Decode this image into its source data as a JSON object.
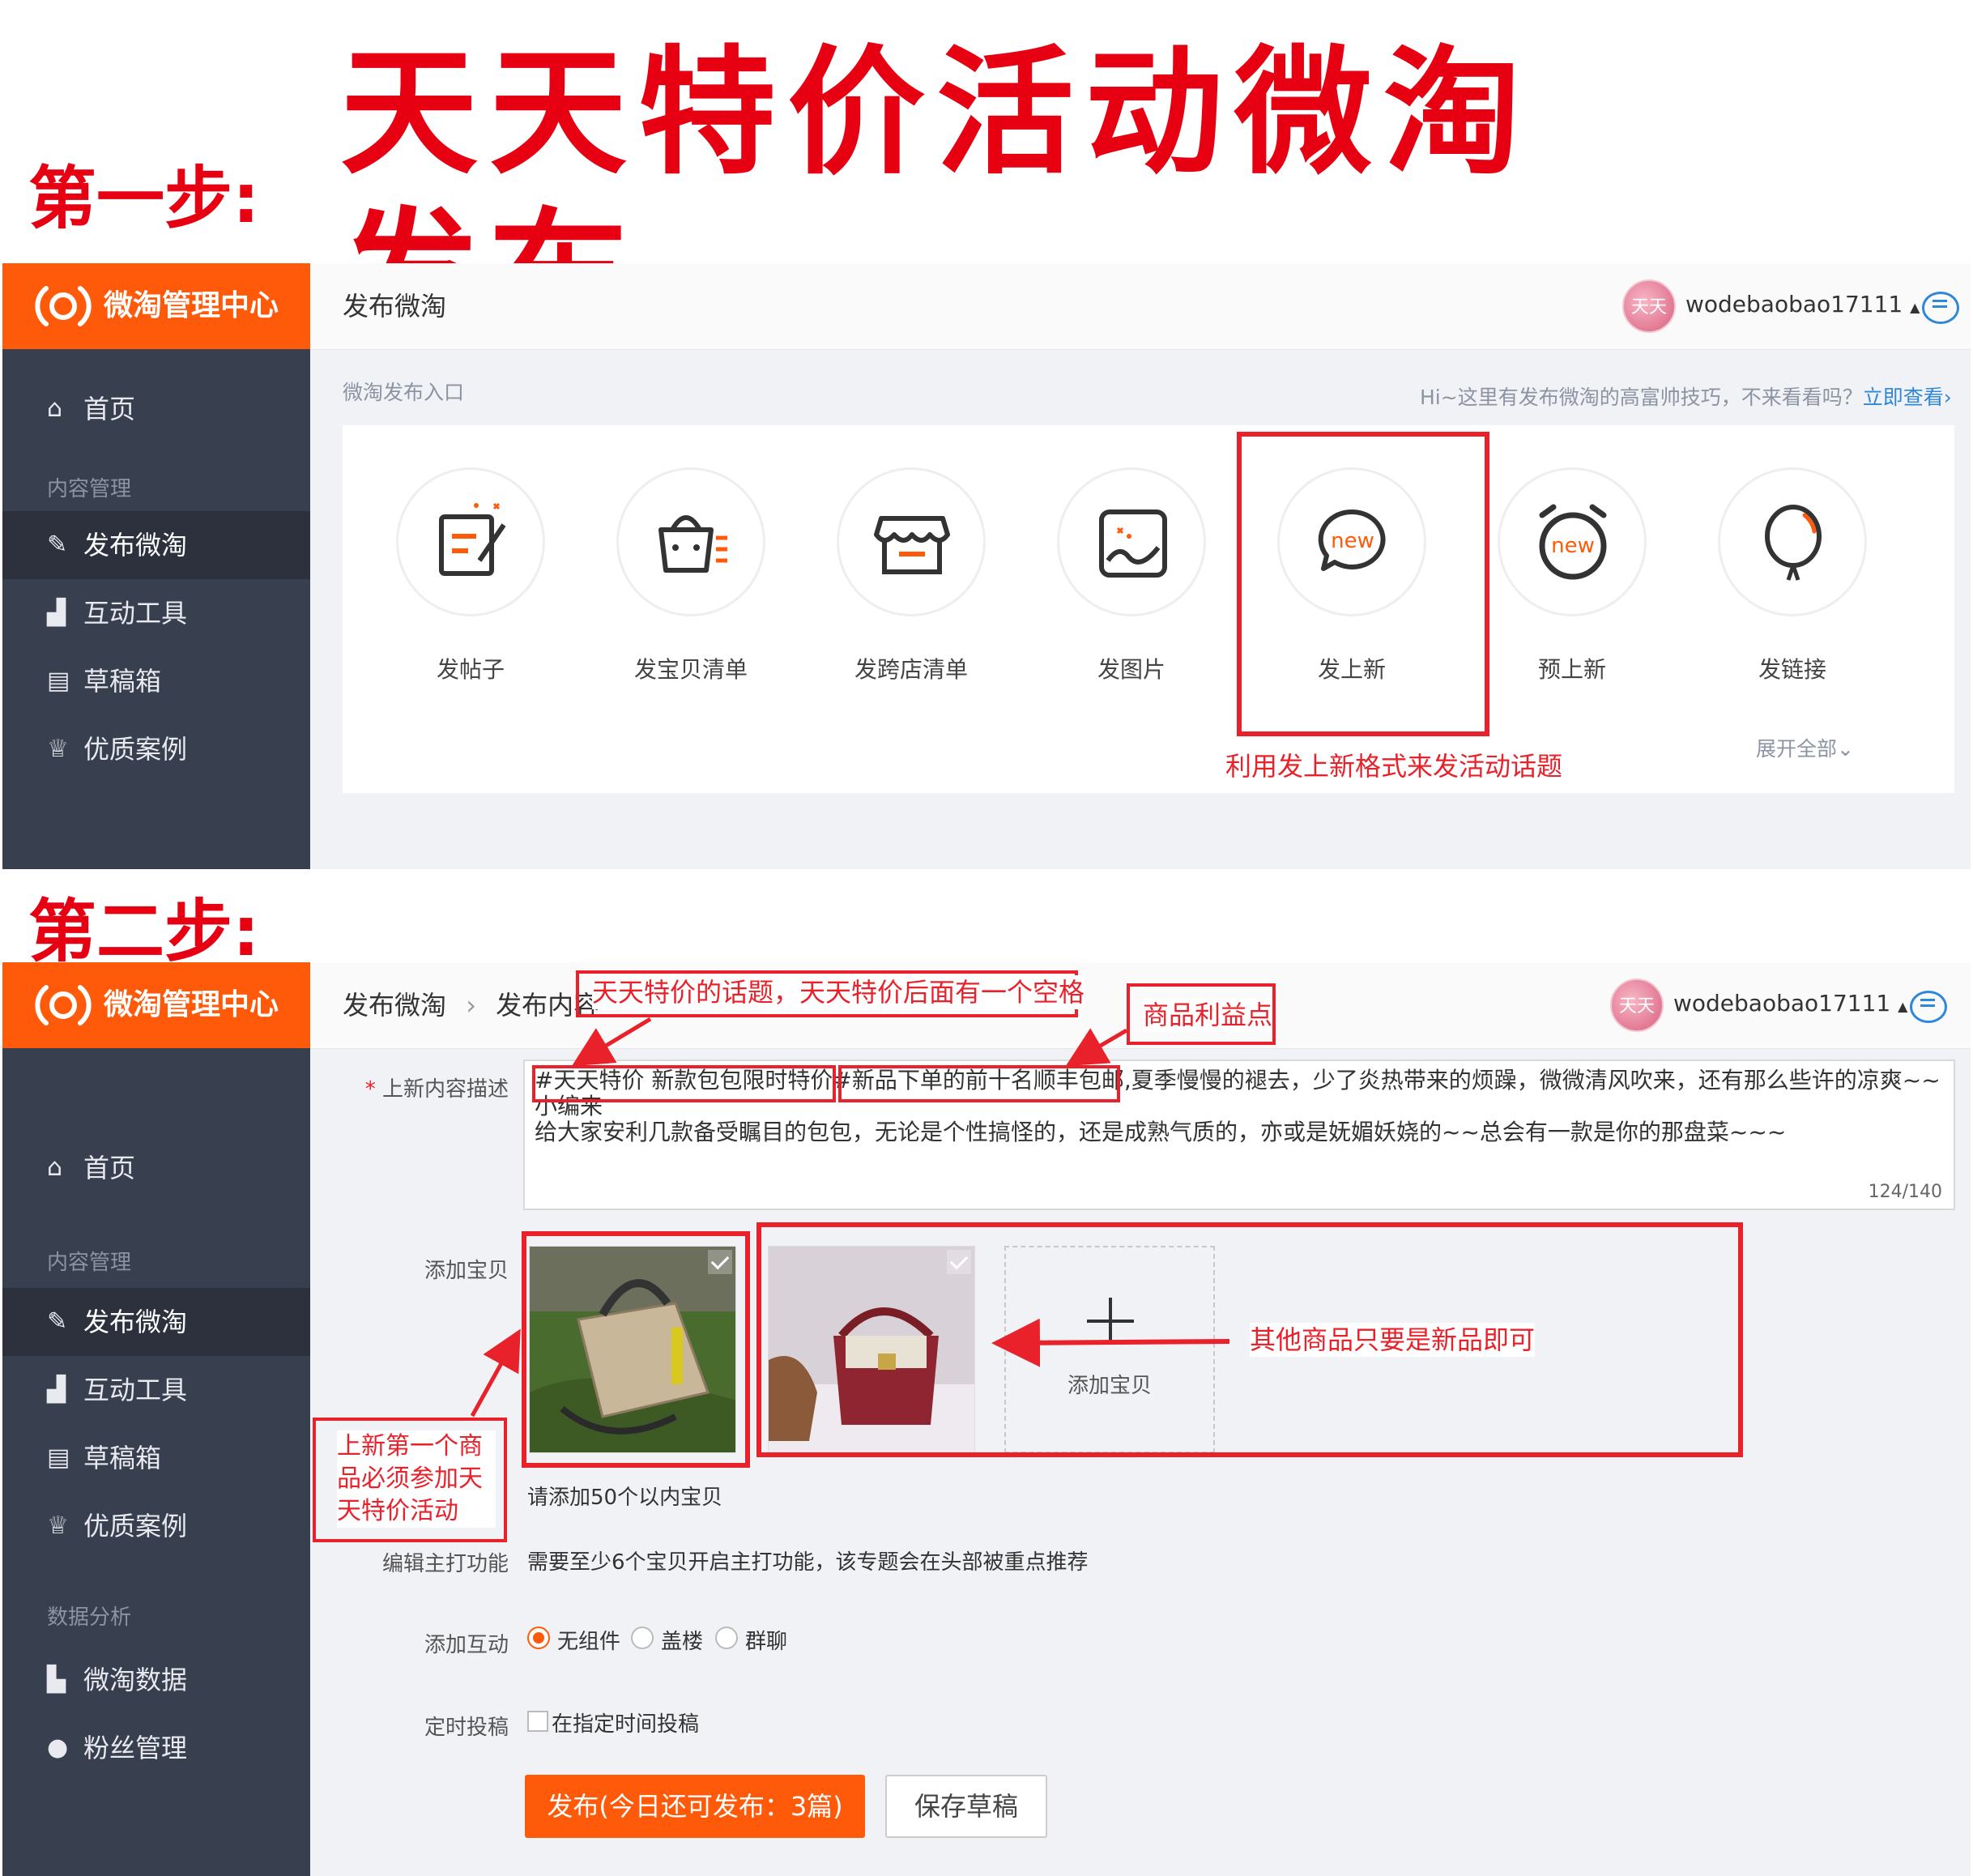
{
  "page": {
    "main_title": "天天特价活动微淘发布",
    "step1_label": "第一步:",
    "step2_label": "第二步:"
  },
  "app": {
    "brand": "微淘管理中心",
    "username": "wodebaobao17111",
    "avatar_text": "天天"
  },
  "sidebar1": {
    "home": "首页",
    "section_content": "内容管理",
    "publish": "发布微淘",
    "interact": "互动工具",
    "drafts": "草稿箱",
    "cases": "优质案例"
  },
  "sidebar2": {
    "home": "首页",
    "section_content": "内容管理",
    "publish": "发布微淘",
    "interact": "互动工具",
    "drafts": "草稿箱",
    "cases": "优质案例",
    "section_data": "数据分析",
    "data": "微淘数据",
    "fans": "粉丝管理"
  },
  "screen1": {
    "header_title": "发布微淘",
    "entry_title": "微淘发布入口",
    "tip_text": "Hi~这里有发布微淘的高富帅技巧，不来看看吗？",
    "tip_link": "立即查看",
    "entries": [
      "发帖子",
      "发宝贝清单",
      "发跨店清单",
      "发图片",
      "发上新",
      "预上新",
      "发链接"
    ],
    "new_badge": "new",
    "expand_all": "展开全部",
    "annotation": "利用发上新格式来发活动话题"
  },
  "screen2": {
    "breadcrumb_root": "发布微淘",
    "breadcrumb_current": "发布内容",
    "label_desc": "上新内容描述",
    "desc_topic": "#天天特价 新款包包限时特价#",
    "desc_benefit": "新品下单的前十名顺丰包邮,",
    "desc_rest_line1": "夏季慢慢的褪去，少了炎热带来的烦躁，微微清风吹来，还有那么些许的凉爽~~小编来",
    "desc_line2": "给大家安利几款备受瞩目的包包，无论是个性搞怪的，还是成熟气质的，亦或是妩媚妖娆的~~总会有一款是你的那盘菜~~~",
    "counter": "124/140",
    "label_add_item": "添加宝贝",
    "add_item_button": "添加宝贝",
    "add_limit": "请添加50个以内宝贝",
    "label_featured": "编辑主打功能",
    "featured_text": "需要至少6个宝贝开启主打功能，该专题会在头部被重点推荐",
    "label_interaction": "添加互动",
    "interaction_options": [
      "无组件",
      "盖楼",
      "群聊"
    ],
    "label_schedule": "定时投稿",
    "schedule_option": "在指定时间投稿",
    "publish_button": "发布(今日还可发布：3篇)",
    "save_button": "保存草稿",
    "annot_topic": "天天特价的话题，天天特价后面有一个空格",
    "annot_benefit": "商品利益点",
    "annot_first_item": "上新第一个商品必须参加天天特价活动",
    "annot_other_items": "其他商品只要是新品即可"
  },
  "colors": {
    "brand_orange": "#ff5a0a",
    "sidebar": "#383f4e",
    "annotation_red": "#e8212a",
    "link_blue": "#2e87d9"
  }
}
